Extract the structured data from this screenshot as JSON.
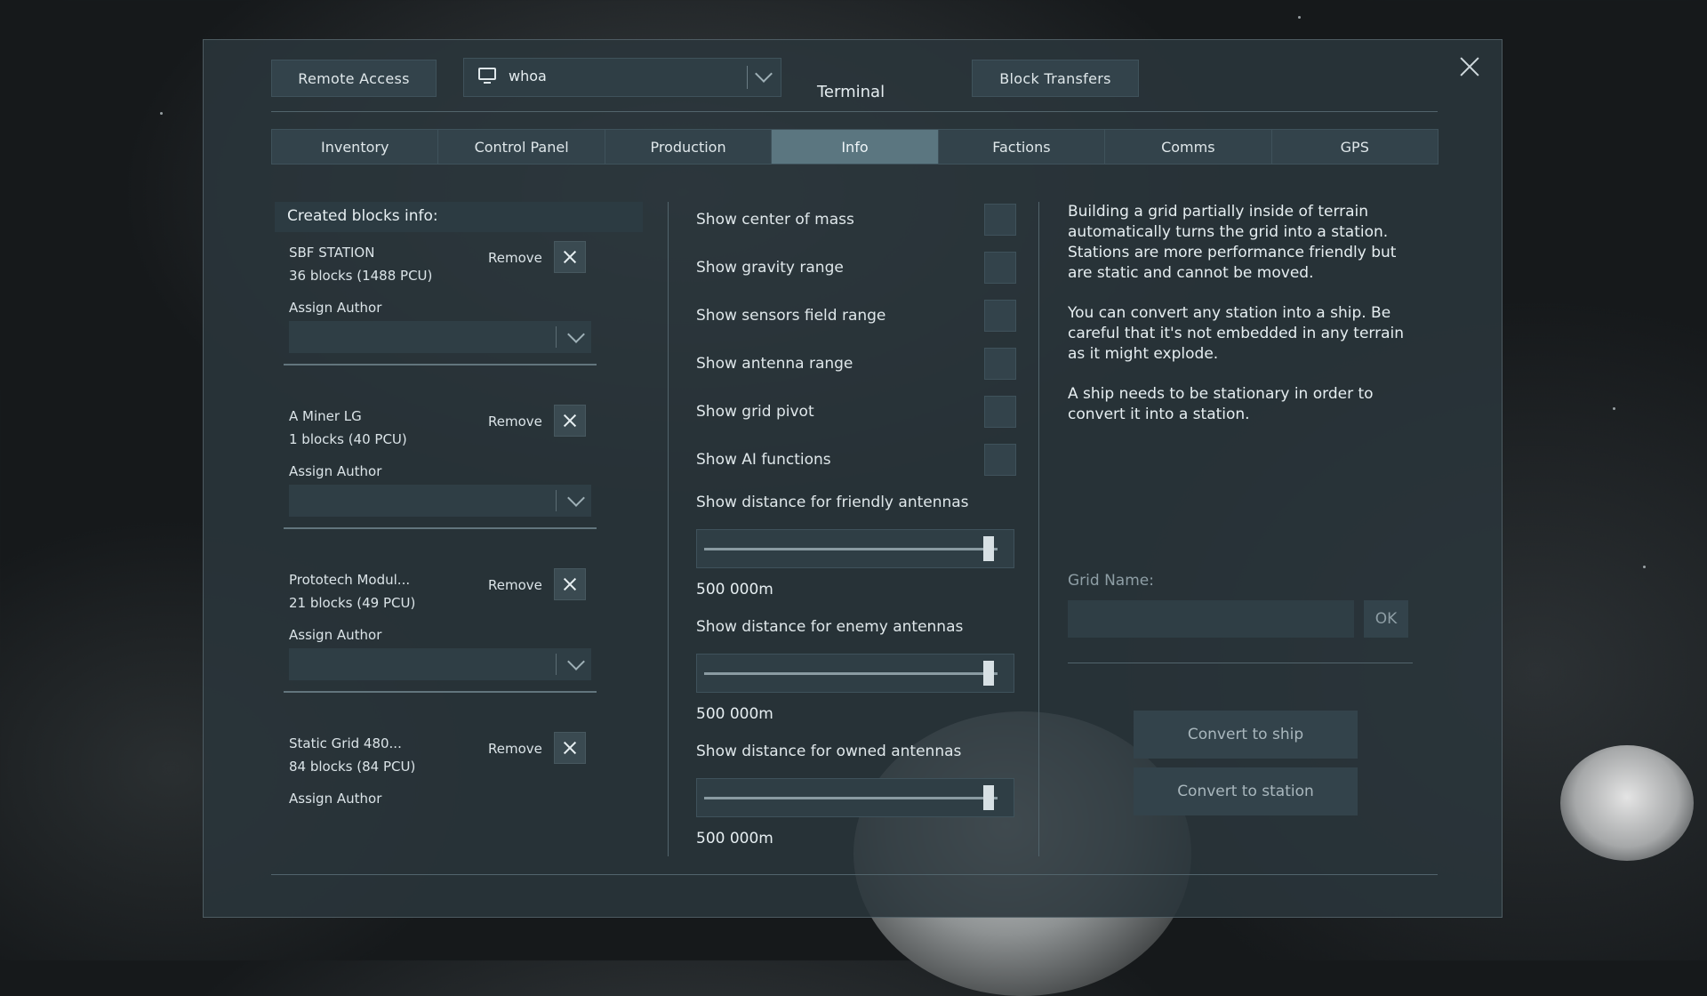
{
  "window": {
    "title": "Terminal",
    "remote_access_label": "Remote Access",
    "block_transfers_label": "Block Transfers",
    "grid_selector_value": "whoa"
  },
  "tabs": [
    {
      "label": "Inventory"
    },
    {
      "label": "Control Panel"
    },
    {
      "label": "Production"
    },
    {
      "label": "Info",
      "active": true
    },
    {
      "label": "Factions"
    },
    {
      "label": "Comms"
    },
    {
      "label": "GPS"
    }
  ],
  "blocks": {
    "header": "Created blocks info:",
    "remove_label": "Remove",
    "assign_author_label": "Assign Author",
    "items": [
      {
        "name": "SBF STATION",
        "count": "36 blocks (1488 PCU)"
      },
      {
        "name": "A Miner LG",
        "count": "1 blocks (40 PCU)"
      },
      {
        "name": "Prototech Modul...",
        "count": "21 blocks (49 PCU)"
      },
      {
        "name": "Static Grid 480...",
        "count": "84 blocks (84 PCU)"
      }
    ]
  },
  "options": {
    "toggles": [
      {
        "label": "Show center of mass",
        "checked": false
      },
      {
        "label": "Show gravity range",
        "checked": false
      },
      {
        "label": "Show sensors field range",
        "checked": false
      },
      {
        "label": "Show antenna range",
        "checked": false
      },
      {
        "label": "Show grid pivot",
        "checked": false
      },
      {
        "label": "Show AI functions",
        "checked": false
      }
    ],
    "sliders": [
      {
        "label": "Show distance for friendly antennas",
        "value": "500 000m",
        "level": 0.97
      },
      {
        "label": "Show distance for enemy antennas",
        "value": "500 000m",
        "level": 0.97
      },
      {
        "label": "Show distance for owned antennas",
        "value": "500 000m",
        "level": 0.97
      }
    ]
  },
  "info": {
    "paragraph1": "Building a grid partially inside of terrain automatically turns the grid into a station. Stations are more performance friendly but are static and cannot be moved.",
    "paragraph2": "You can convert any station into a ship. Be careful that it's not embedded in any terrain as it might explode.",
    "paragraph3": "A ship needs to be stationary in order to convert it into a station.",
    "grid_name_label": "Grid Name:",
    "grid_name_value": "",
    "ok_label": "OK",
    "convert_to_ship_label": "Convert to ship",
    "convert_to_station_label": "Convert to station"
  }
}
